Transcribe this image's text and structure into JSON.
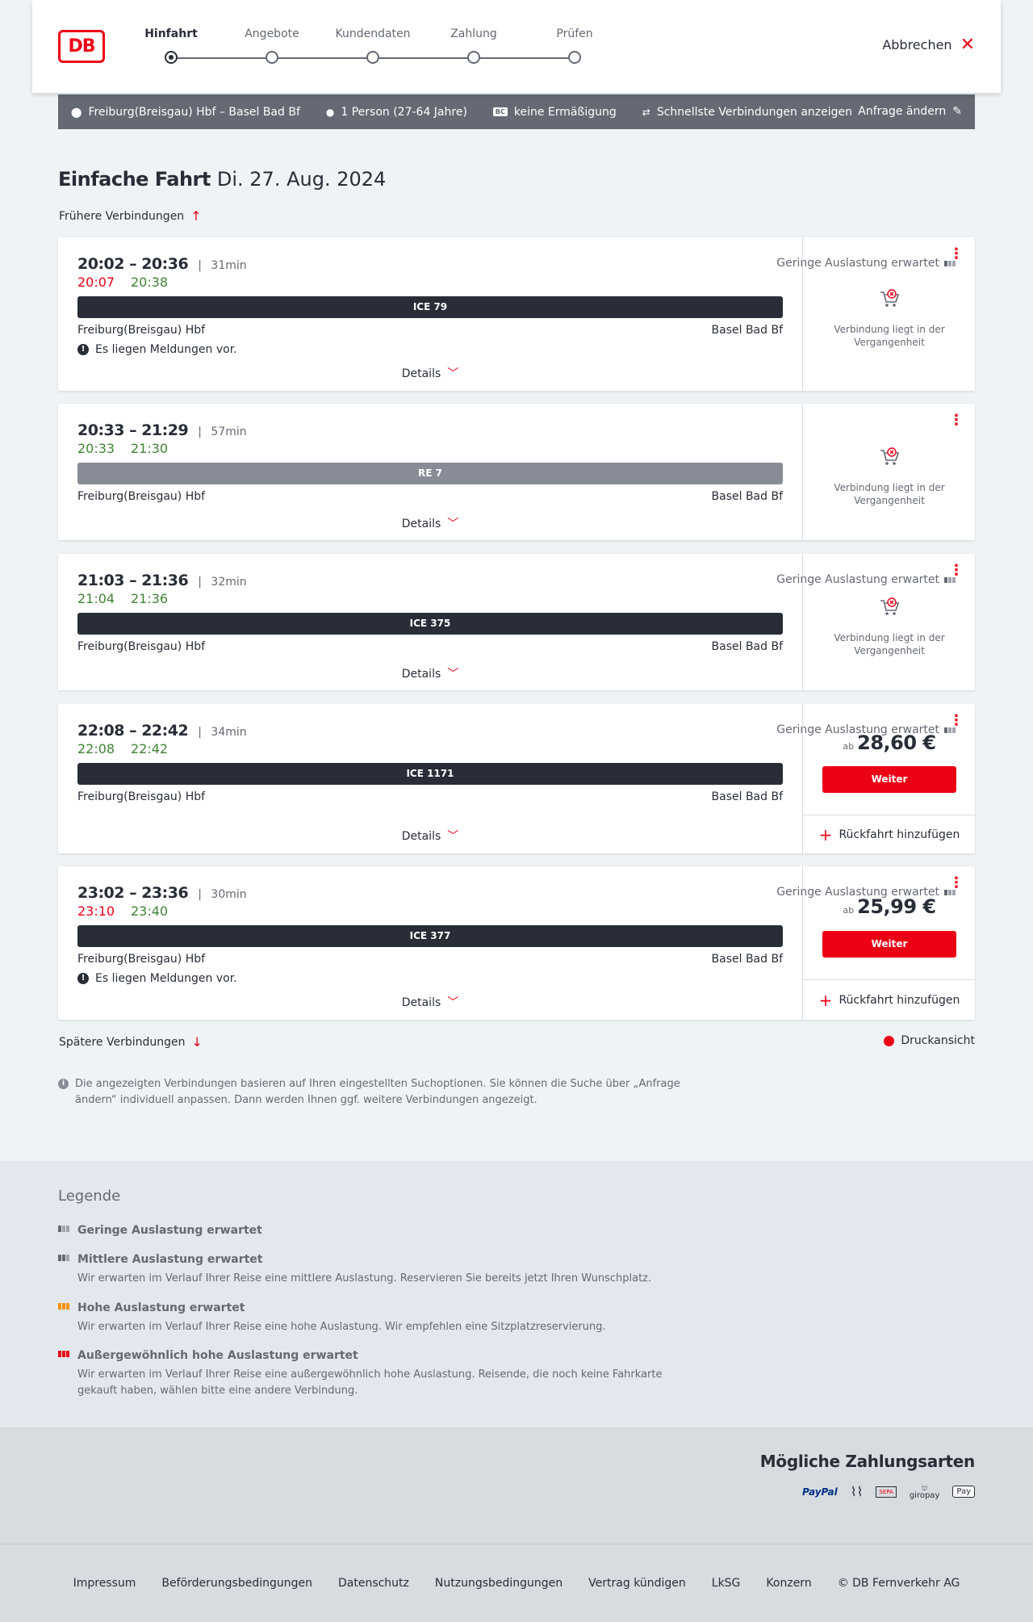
{
  "header": {
    "logo": "DB",
    "steps": [
      {
        "label": "Hinfahrt",
        "active": true
      },
      {
        "label": "Angebote",
        "active": false
      },
      {
        "label": "Kundendaten",
        "active": false
      },
      {
        "label": "Zahlung",
        "active": false
      },
      {
        "label": "Prüfen",
        "active": false
      }
    ],
    "cancel_label": "Abbrechen"
  },
  "query": {
    "route": "Freiburg(Breisgau) Hbf – Basel Bad Bf",
    "persons": "1 Person (27-64 Jahre)",
    "discount_badge": "BC",
    "discount": "keine Ermäßigung",
    "fastest": "Schnellste Verbindungen anzeigen",
    "change": "Anfrage ändern"
  },
  "title": {
    "type": "Einfache Fahrt",
    "date": "Di. 27. Aug. 2024"
  },
  "earlier_label": "Frühere Verbindungen",
  "later_label": "Spätere Verbindungen",
  "print_label": "Druckansicht",
  "connections": [
    {
      "times": "20:02 – 20:36",
      "duration": "31min",
      "rt_dep": "20:07",
      "rt_arr": "20:38",
      "rt_dep_status": "late",
      "rt_arr_status": "ok",
      "load": "Geringe Auslastung erwartet",
      "train": "ICE 79",
      "from": "Freiburg(Breisgau) Hbf",
      "to": "Basel Bad Bf",
      "message": "Es liegen Meldungen vor.",
      "details": "Details",
      "past": "Verbindung liegt in der Vergangenheit"
    },
    {
      "times": "20:33 – 21:29",
      "duration": "57min",
      "rt_dep": "20:33",
      "rt_arr": "21:30",
      "rt_dep_status": "ok",
      "rt_arr_status": "ok",
      "load": "",
      "train": "RE 7",
      "from": "Freiburg(Breisgau) Hbf",
      "to": "Basel Bad Bf",
      "message": "",
      "details": "Details",
      "past": "Verbindung liegt in der Vergangenheit"
    },
    {
      "times": "21:03 – 21:36",
      "duration": "32min",
      "rt_dep": "21:04",
      "rt_arr": "21:36",
      "rt_dep_status": "ok",
      "rt_arr_status": "ok",
      "load": "Geringe Auslastung erwartet",
      "train": "ICE 375",
      "from": "Freiburg(Breisgau) Hbf",
      "to": "Basel Bad Bf",
      "message": "",
      "details": "Details",
      "past": "Verbindung liegt in der Vergangenheit"
    },
    {
      "times": "22:08 – 22:42",
      "duration": "34min",
      "rt_dep": "22:08",
      "rt_arr": "22:42",
      "rt_dep_status": "ok",
      "rt_arr_status": "ok",
      "load": "Geringe Auslastung erwartet",
      "train": "ICE 1171",
      "from": "Freiburg(Breisgau) Hbf",
      "to": "Basel Bad Bf",
      "message": "",
      "details": "Details",
      "price_prefix": "ab",
      "price": "28,60 €",
      "button": "Weiter",
      "return": "Rückfahrt hinzufügen"
    },
    {
      "times": "23:02 – 23:36",
      "duration": "30min",
      "rt_dep": "23:10",
      "rt_arr": "23:40",
      "rt_dep_status": "late",
      "rt_arr_status": "ok",
      "load": "Geringe Auslastung erwartet",
      "train": "ICE 377",
      "from": "Freiburg(Breisgau) Hbf",
      "to": "Basel Bad Bf",
      "message": "Es liegen Meldungen vor.",
      "details": "Details",
      "price_prefix": "ab",
      "price": "25,99 €",
      "button": "Weiter",
      "return": "Rückfahrt hinzufügen"
    }
  ],
  "info_text": "Die angezeigten Verbindungen basieren auf Ihren eingestellten Suchoptionen. Sie können die Suche über „Anfrage ändern“ individuell anpassen. Dann werden Ihnen ggf. weitere Verbindungen angezeigt.",
  "legend": {
    "title": "Legende",
    "items": [
      {
        "title": "Geringe Auslastung erwartet",
        "desc": ""
      },
      {
        "title": "Mittlere Auslastung erwartet",
        "desc": "Wir erwarten im Verlauf Ihrer Reise eine mittlere Auslastung. Reservieren Sie bereits jetzt Ihren Wunschplatz."
      },
      {
        "title": "Hohe Auslastung erwartet",
        "desc": "Wir erwarten im Verlauf Ihrer Reise eine hohe Auslastung. Wir empfehlen eine Sitzplatzreservierung."
      },
      {
        "title": "Außergewöhnlich hohe Auslastung erwartet",
        "desc": "Wir erwarten im Verlauf Ihrer Reise eine außergewöhnlich hohe Auslastung. Reisende, die noch keine Fahrkarte gekauft haben, wählen bitte eine andere Verbindung."
      }
    ],
    "colors": [
      "#646973",
      "#646973",
      "#f39200",
      "#ec0016"
    ]
  },
  "payment": {
    "title": "Mögliche Zahlungsarten",
    "methods": [
      "PayPal",
      "SEPA",
      "giropay",
      "Pay"
    ]
  },
  "footer": {
    "links": [
      "Impressum",
      "Beförderungsbedingungen",
      "Datenschutz",
      "Nutzungsbedingungen",
      "Vertrag kündigen",
      "LkSG",
      "Konzern",
      "© DB Fernverkehr AG"
    ]
  },
  "colors": {
    "brand": "#ec0016",
    "dark": "#282d37",
    "delay": "#ec0016",
    "ontime": "#408335"
  }
}
